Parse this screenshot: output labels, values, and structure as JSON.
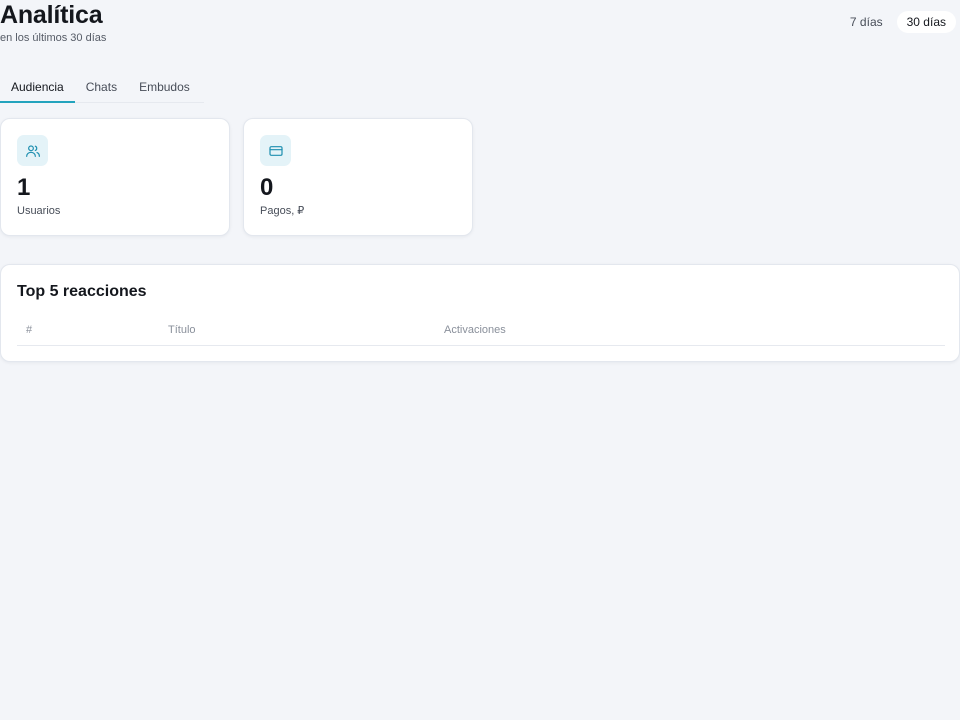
{
  "header": {
    "title": "Analítica",
    "subtitle": "en los últimos 30 días"
  },
  "range": {
    "options": [
      "7 días",
      "30 días"
    ],
    "selected": "30 días"
  },
  "tabs": [
    {
      "label": "Audiencia",
      "active": true
    },
    {
      "label": "Chats",
      "active": false
    },
    {
      "label": "Embudos",
      "active": false
    }
  ],
  "stats": {
    "users": {
      "value": "1",
      "label": "Usuarios",
      "icon": "users-icon"
    },
    "payments": {
      "value": "0",
      "label": "Pagos, ₽",
      "icon": "credit-card-icon"
    }
  },
  "reactions": {
    "title": "Top 5 reacciones",
    "columns": [
      "#",
      "Título",
      "Activaciones"
    ],
    "rows": []
  },
  "colors": {
    "accent": "#23a3bd",
    "icon_bg": "#e4f3f8",
    "background": "#f3f5f9"
  }
}
